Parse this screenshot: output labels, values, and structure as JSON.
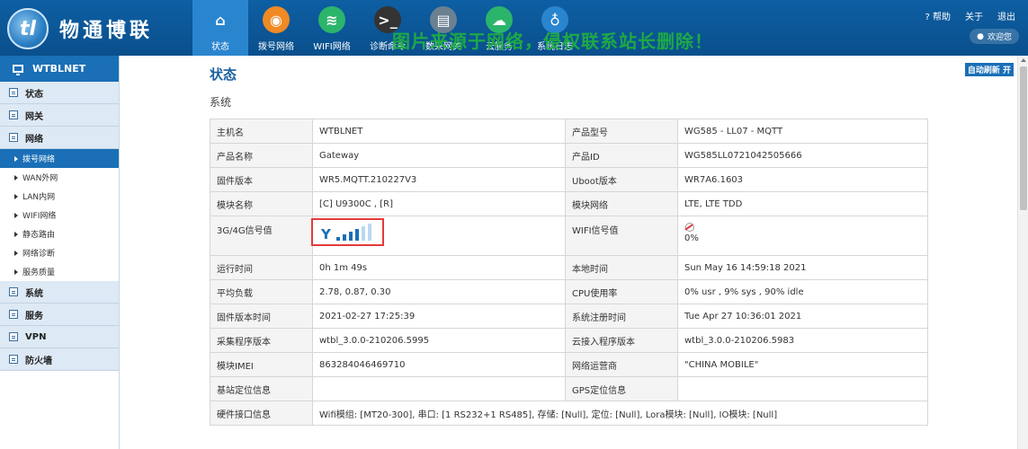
{
  "header": {
    "logo_mark": "tl",
    "logo_text": "物通博联",
    "nav": [
      {
        "label": "状态",
        "icon": "home-icon",
        "color": "#2a85cf"
      },
      {
        "label": "拨号网络",
        "icon": "dialup-icon",
        "color": "#f08a24"
      },
      {
        "label": "WIFI网络",
        "icon": "wifi-icon",
        "color": "#2bb56b"
      },
      {
        "label": "诊断命令",
        "icon": "terminal-icon",
        "color": "#333333"
      },
      {
        "label": "数采网关",
        "icon": "gateway-icon",
        "color": "#6b8090"
      },
      {
        "label": "云服务",
        "icon": "cloud-icon",
        "color": "#2bb56b"
      },
      {
        "label": "系统日志",
        "icon": "stethoscope-icon",
        "color": "#2a85cf"
      }
    ],
    "watermark": "图片来源于网络，侵权联系站长删除！",
    "links": {
      "help": "帮助",
      "about": "关于",
      "logout": "退出"
    },
    "help_mark": "?",
    "user": "欢迎您"
  },
  "sidebar": {
    "title": "WTBLNET",
    "sections": [
      {
        "label": "状态"
      },
      {
        "label": "网关"
      },
      {
        "label": "网络"
      }
    ],
    "network_items": [
      "拨号网络",
      "WAN外网",
      "LAN内网",
      "WIFI网络",
      "静态路由",
      "网络诊断",
      "服务质量"
    ],
    "sections_after": [
      {
        "label": "系统"
      },
      {
        "label": "服务"
      },
      {
        "label": "VPN"
      },
      {
        "label": "防火墙"
      }
    ]
  },
  "main": {
    "title": "状态",
    "auto_refresh": "自动刷新 开",
    "section": "系统"
  },
  "info": {
    "hostname_k": "主机名",
    "hostname_v": "WTBLNET",
    "model_k": "产品型号",
    "model_v": "WG585 - LL07 - MQTT",
    "product_name_k": "产品名称",
    "product_name_v": "Gateway",
    "product_id_k": "产品ID",
    "product_id_v": "WG585LL0721042505666",
    "fw_k": "固件版本",
    "fw_v": "WR5.MQTT.210227V3",
    "uboot_k": "Uboot版本",
    "uboot_v": "WR7A6.1603",
    "module_k": "模块名称",
    "module_v": "[C] U9300C , [R]",
    "module_net_k": "模块网络",
    "module_net_v": "LTE, LTE TDD",
    "signal_k": "3G/4G信号值",
    "signal_level": 0.6,
    "wifi_sig_k": "WIFI信号值",
    "wifi_sig_v": "0%",
    "uptime_k": "运行时间",
    "uptime_v": "0h 1m 49s",
    "localtime_k": "本地时间",
    "localtime_v": "Sun May 16 14:59:18 2021",
    "load_k": "平均负载",
    "load_v": "2.78, 0.87, 0.30",
    "cpu_k": "CPU使用率",
    "cpu_v": "0% usr , 9% sys , 90% idle",
    "fw_time_k": "固件版本时间",
    "fw_time_v": "2021-02-27 17:25:39",
    "reg_time_k": "系统注册时间",
    "reg_time_v": "Tue Apr 27 10:36:01 2021",
    "collector_k": "采集程序版本",
    "collector_v": "wtbl_3.0.0-210206.5995",
    "cloud_k": "云接入程序版本",
    "cloud_v": "wtbl_3.0.0-210206.5983",
    "imei_k": "模块IMEI",
    "imei_v": "863284046469710",
    "operator_k": "网络运营商",
    "operator_v": "\"CHINA MOBILE\"",
    "base_k": "基站定位信息",
    "base_v": "",
    "gps_k": "GPS定位信息",
    "gps_v": "",
    "hw_k": "硬件接口信息",
    "hw_v": "Wifi模组: [MT20-300],  串口: [1 RS232+1 RS485],   存储: [Null],  定位: [Null],  Lora模块: [Null],   IO模块: [Null]"
  }
}
